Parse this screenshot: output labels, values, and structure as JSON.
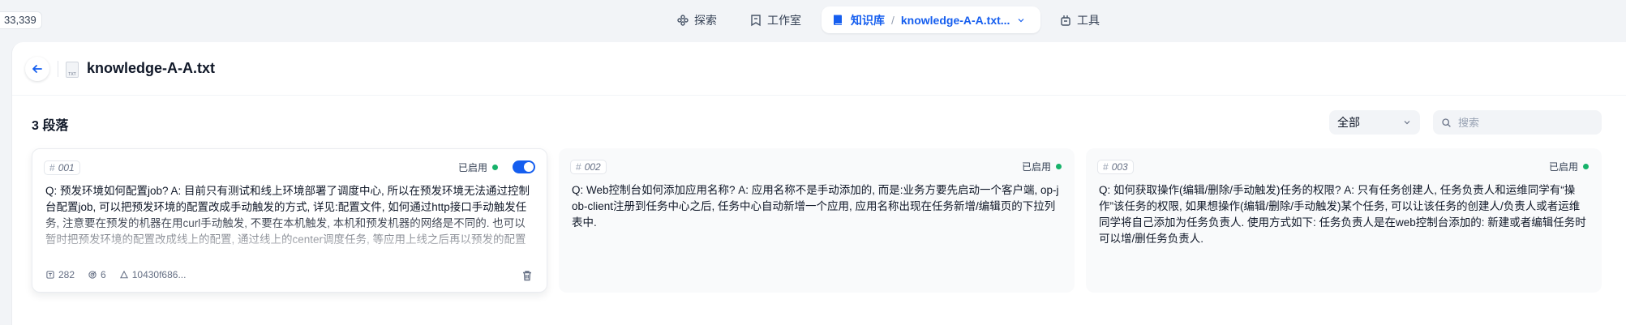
{
  "corner_label": "33,339",
  "nav": {
    "explore": "探索",
    "studio": "工作室",
    "knowledge": "知识库",
    "doc_crumb": "knowledge-A-A.txt...",
    "tools": "工具"
  },
  "doc": {
    "title": "knowledge-A-A.txt",
    "file_type": "TXT"
  },
  "segments_count": "3 段落",
  "filter": {
    "selected": "全部"
  },
  "search": {
    "placeholder": "搜索",
    "value": ""
  },
  "colors": {
    "accent": "#155eef",
    "enabled_dot": "#17b26a"
  },
  "segments": [
    {
      "id": "001",
      "status": "已启用",
      "enabled": true,
      "content": "Q: 预发环境如何配置job? A: 目前只有测试和线上环境部署了调度中心, 所以在预发环境无法通过控制台配置job, 可以把预发环境的配置改成手动触发的方式, 详见:配置文件, 如何通过http接口手动触发任务, 注意要在预发的机器在用curl手动触发, 不要在本机触发, 本机和预发机器的网络是不同的. 也可以暂时把预发环境的配置改成线上的配置, 通过线上的center调度任务, 等应用上线之后再以预发的配置下线(预发和线上的job配置一致), 需要注意的是这样可能会导致线上的center把任务调度到预发机器上",
      "word_count": "282",
      "hit_count": "6",
      "hash": "10430f686..."
    },
    {
      "id": "002",
      "status": "已启用",
      "enabled": true,
      "content": "Q: Web控制台如何添加应用名称? A: 应用名称不是手动添加的, 而是:业务方要先启动一个客户端, op-job-client注册到任务中心之后, 任务中心自动新增一个应用, 应用名称出现在任务新增/编辑页的下拉列表中."
    },
    {
      "id": "003",
      "status": "已启用",
      "enabled": true,
      "content": "Q: 如何获取操作(编辑/删除/手动触发)任务的权限? A: 只有任务创建人, 任务负责人和运维同学有“操作”该任务的权限, 如果想操作(编辑/删除/手动触发)某个任务, 可以让该任务的创建人/负责人或者运维同学将自己添加为任务负责人. 使用方式如下: 任务负责人是在web控制台添加的: 新建或者编辑任务时可以增/删任务负责人."
    }
  ]
}
